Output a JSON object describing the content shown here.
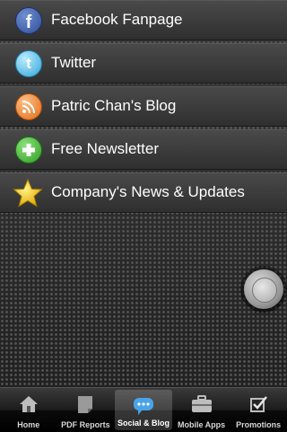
{
  "menu": {
    "items": [
      {
        "label": "Facebook Fanpage",
        "icon": "facebook-icon"
      },
      {
        "label": "Twitter",
        "icon": "twitter-icon"
      },
      {
        "label": "Patric Chan's Blog",
        "icon": "rss-icon"
      },
      {
        "label": "Free Newsletter",
        "icon": "plus-icon"
      },
      {
        "label": "Company's News & Updates",
        "icon": "star-icon"
      }
    ]
  },
  "tabbar": {
    "active": "Social & Blog",
    "tabs": [
      {
        "label": "Home",
        "icon": "home-icon"
      },
      {
        "label": "PDF Reports",
        "icon": "document-icon"
      },
      {
        "label": "Social & Blog",
        "icon": "chat-bubble-icon"
      },
      {
        "label": "Mobile Apps",
        "icon": "briefcase-icon"
      },
      {
        "label": "Promotions",
        "icon": "checkbox-icon"
      }
    ]
  },
  "colors": {
    "text": "#ffffff",
    "facebook": "#3b5998",
    "twitter": "#35a5d8",
    "rss": "#e06a12",
    "newsletter": "#2f9f23",
    "star": "#f5c400",
    "active_tab_icon": "#4aa3e8"
  }
}
